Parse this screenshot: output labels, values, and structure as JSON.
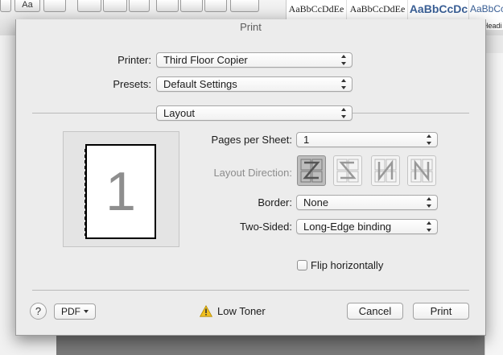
{
  "background": {
    "toolbar_font_label": "Aa",
    "styles": [
      {
        "sample": "AaBbCcDdEe"
      },
      {
        "sample": "AaBbCcDdEe"
      },
      {
        "sample": "AaBbCcDc"
      },
      {
        "sample": "AaBbCc",
        "name": "Headi"
      }
    ]
  },
  "dialog": {
    "title": "Print",
    "printer": {
      "label": "Printer:",
      "value": "Third Floor Copier"
    },
    "presets": {
      "label": "Presets:",
      "value": "Default Settings"
    },
    "section_popup": {
      "value": "Layout"
    },
    "preview": {
      "page_number": "1"
    },
    "pages_per_sheet": {
      "label": "Pages per Sheet:",
      "value": "1"
    },
    "layout_direction": {
      "label": "Layout Direction:"
    },
    "border": {
      "label": "Border:",
      "value": "None"
    },
    "two_sided": {
      "label": "Two-Sided:",
      "value": "Long-Edge binding"
    },
    "flip": {
      "label": "Flip horizontally",
      "checked": false
    },
    "help_label": "?",
    "pdf_label": "PDF",
    "status": {
      "icon": "warning-icon",
      "text": "Low Toner"
    },
    "cancel_label": "Cancel",
    "print_label": "Print"
  },
  "colors": {
    "dialog_bg": "#ececec",
    "warning": "#f0c020"
  }
}
